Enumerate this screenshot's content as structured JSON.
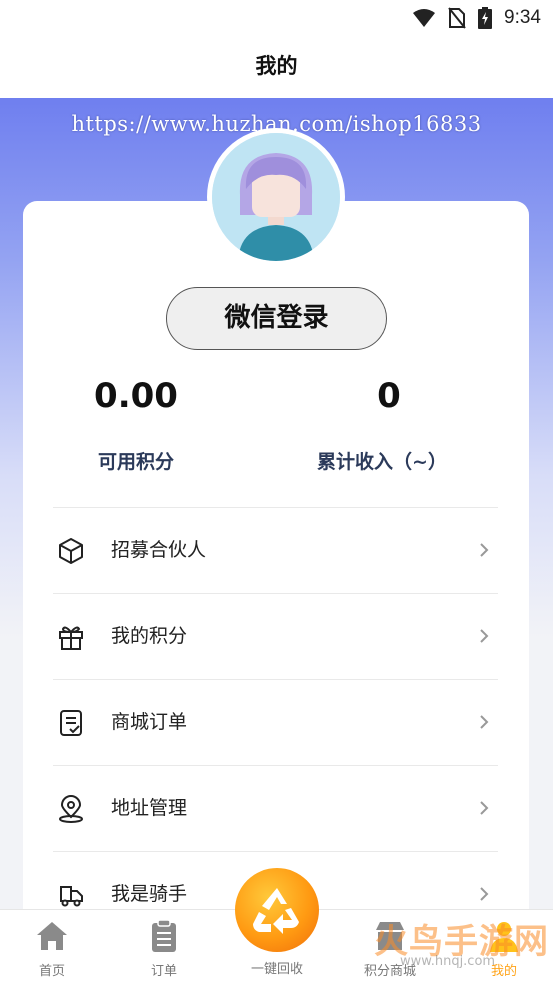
{
  "status_bar": {
    "time": "9:34",
    "icons": [
      "wifi-icon",
      "no-sim-icon",
      "battery-charging-icon"
    ]
  },
  "header": {
    "title": "我的"
  },
  "watermark": {
    "url": "https://www.huzhan.com/ishop16833"
  },
  "profile": {
    "login_label": "微信登录",
    "stats": [
      {
        "value": "0.00",
        "label": "可用积分"
      },
      {
        "value": "0",
        "label": "累计收入（~）"
      }
    ]
  },
  "menu": [
    {
      "label": "招募合伙人",
      "icon": "box-icon"
    },
    {
      "label": "我的积分",
      "icon": "gift-icon"
    },
    {
      "label": "商城订单",
      "icon": "order-list-icon"
    },
    {
      "label": "地址管理",
      "icon": "location-pin-icon"
    },
    {
      "label": "我是骑手",
      "icon": "delivery-truck-icon"
    }
  ],
  "bottom_nav": {
    "items": [
      {
        "label": "首页",
        "icon": "home-icon"
      },
      {
        "label": "订单",
        "icon": "clipboard-icon"
      },
      {
        "label": "一键回收",
        "icon": "recycle-icon"
      },
      {
        "label": "积分商城",
        "icon": "shop-icon"
      },
      {
        "label": "我的",
        "icon": "user-icon"
      }
    ],
    "accent_color": "#ff9a12"
  },
  "corner_watermark": {
    "title": "火鸟手游网",
    "url": "www.hnqj.com"
  },
  "colors": {
    "gradient_top": "#6f7fef",
    "card": "#ffffff",
    "stat_label": "#2b3a5a"
  }
}
